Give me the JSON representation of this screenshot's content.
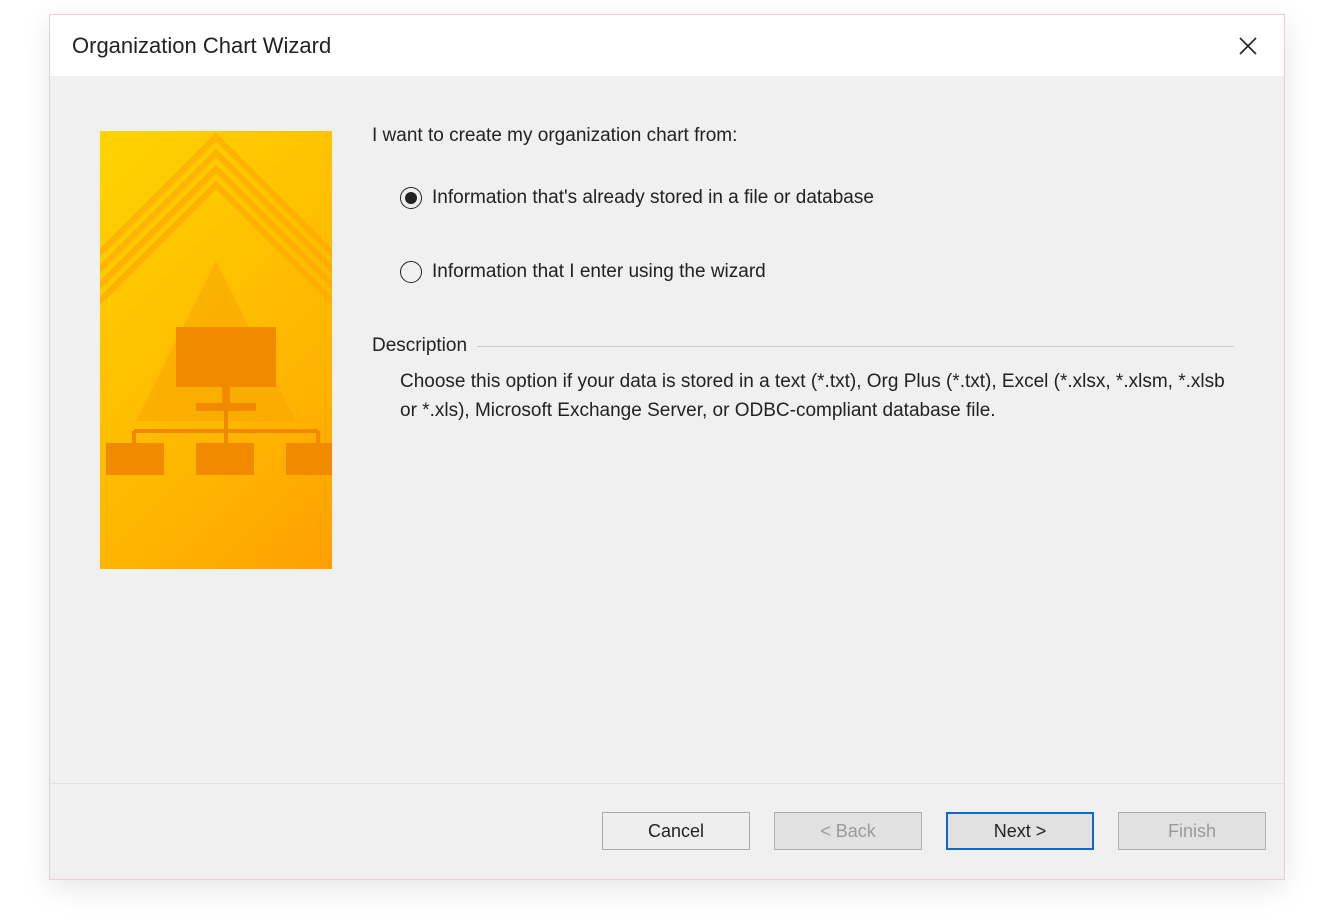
{
  "window": {
    "title": "Organization Chart Wizard"
  },
  "main": {
    "prompt": "I want to create my organization chart from:",
    "options": [
      {
        "label": "Information that's already stored in a file or database",
        "selected": true
      },
      {
        "label": "Information that I enter using the wizard",
        "selected": false
      }
    ],
    "description_heading": "Description",
    "description_text": "Choose this option if your data is stored in a text (*.txt), Org Plus (*.txt), Excel (*.xlsx, *.xlsm, *.xlsb or *.xls), Microsoft Exchange Server, or ODBC-compliant database file."
  },
  "buttons": {
    "cancel": "Cancel",
    "back": "< Back",
    "next": "Next >",
    "finish": "Finish"
  }
}
